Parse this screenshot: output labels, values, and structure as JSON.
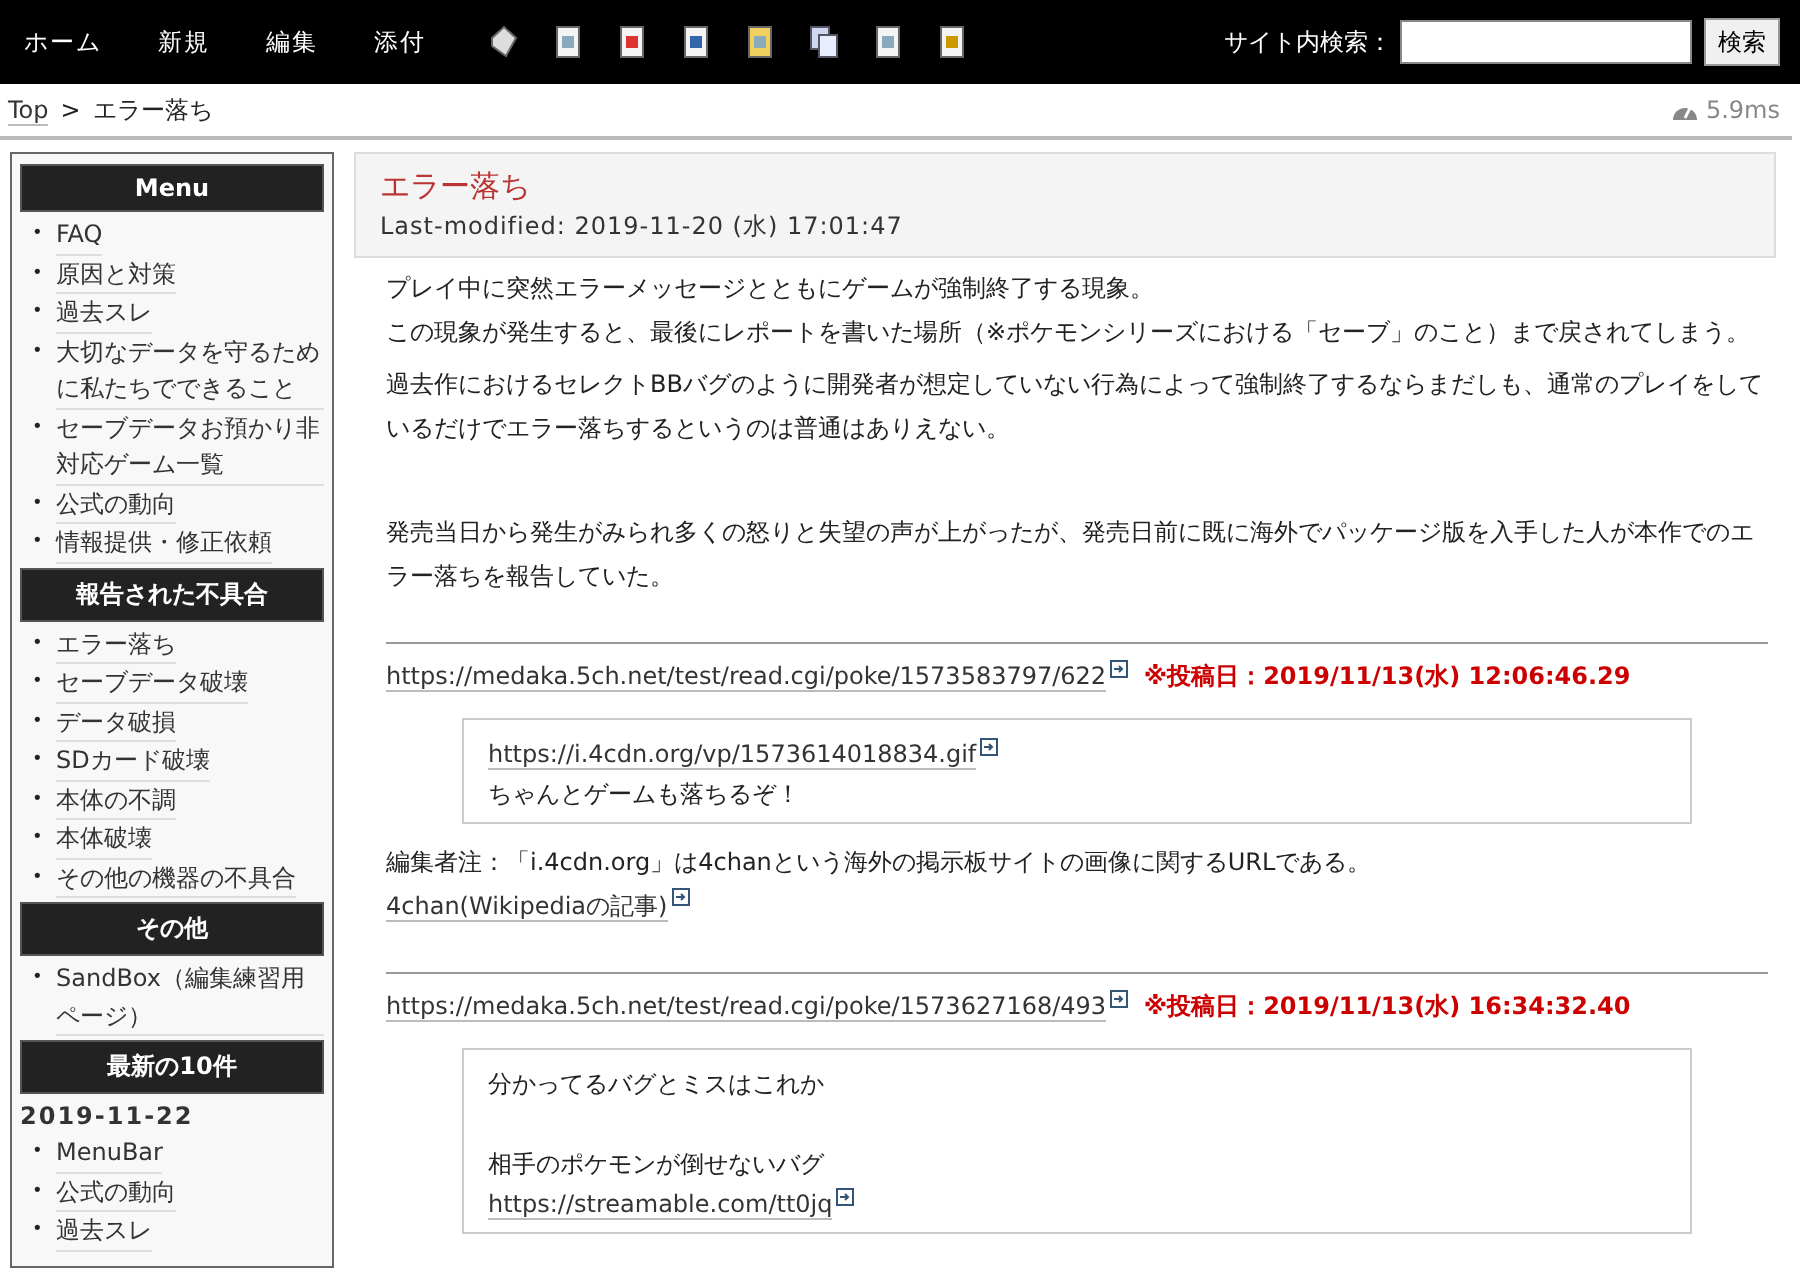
{
  "navbar": {
    "links": [
      "ホーム",
      "新規",
      "編集",
      "添付"
    ],
    "search_label": "サイト内検索：",
    "search_button": "検索"
  },
  "breadcrumb": {
    "items": [
      "Top",
      "エラー落ち"
    ],
    "separator": ">"
  },
  "timing": "5.9ms",
  "sidebar": {
    "bullet": "•",
    "sections": [
      {
        "heading": "Menu",
        "items": [
          "FAQ",
          "原因と対策",
          "過去スレ",
          "大切なデータを守るために私たちでできること",
          "セーブデータお預かり非対応ゲーム一覧",
          "公式の動向",
          "情報提供・修正依頼"
        ]
      },
      {
        "heading": "報告された不具合",
        "items": [
          "エラー落ち",
          "セーブデータ破壊",
          "データ破損",
          "SDカード破壊",
          "本体の不調",
          "本体破壊",
          "その他の機器の不具合"
        ]
      },
      {
        "heading": "その他",
        "items": [
          "SandBox（編集練習用ページ）"
        ]
      },
      {
        "heading": "最新の10件",
        "date": "2019-11-22",
        "items": [
          "MenuBar",
          "公式の動向",
          "過去スレ"
        ]
      }
    ]
  },
  "page": {
    "title": "エラー落ち",
    "last_modified": "Last-modified: 2019-11-20 (水) 17:01:47",
    "paragraphs": [
      [
        "プレイ中に突然エラーメッセージとともにゲームが強制終了する現象。",
        "この現象が発生すると、最後にレポートを書いた場所（※ポケモンシリーズにおける「セーブ」のこと）まで戻されてしまう。"
      ],
      [
        "過去作におけるセレクトBBバグのように開発者が想定していない行為によって強制終了するならまだしも、通常のプレイをしているだけでエラー落ちするというのは普通はありえない。"
      ]
    ],
    "summary": "発売当日から発生がみられ多くの怒りと失望の声が上がったが、発売日前に既に海外でパッケージ版を入手した人が本作でのエラー落ちを報告していた。",
    "posts": [
      {
        "url": "https://medaka.5ch.net/test/read.cgi/poke/1573583797/622",
        "posted": "※投稿日：2019/11/13(水) 12:06:46.29",
        "quote": [
          {
            "kind": "link",
            "text": "https://i.4cdn.org/vp/1573614018834.gif"
          },
          {
            "kind": "text",
            "text": "ちゃんとゲームも落ちるぞ！"
          }
        ],
        "notes": [
          {
            "kind": "text",
            "text": "編集者注：「i.4cdn.org」は4chanという海外の掲示板サイトの画像に関するURLである。"
          },
          {
            "kind": "link",
            "text": "4chan(Wikipediaの記事)"
          }
        ]
      },
      {
        "url": "https://medaka.5ch.net/test/read.cgi/poke/1573627168/493",
        "posted": "※投稿日：2019/11/13(水) 16:34:32.40",
        "quote": [
          {
            "kind": "text",
            "text": "分かってるバグとミスはこれか"
          },
          {
            "kind": "blank"
          },
          {
            "kind": "text",
            "text": "相手のポケモンが倒せないバグ"
          },
          {
            "kind": "link",
            "text": "https://streamable.com/tt0jq"
          }
        ]
      }
    ]
  }
}
